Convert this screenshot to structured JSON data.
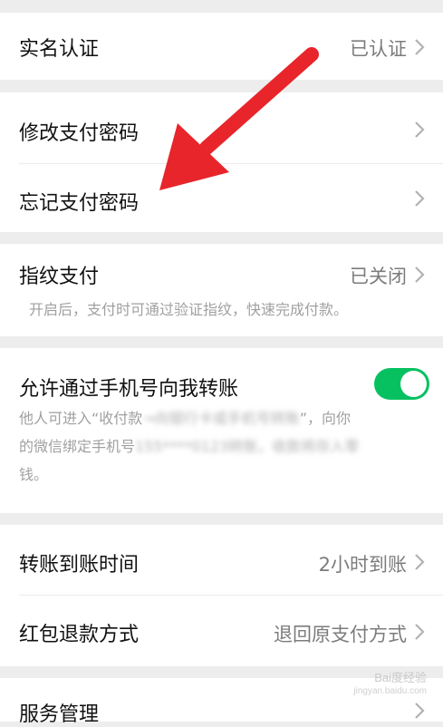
{
  "sections": {
    "realname": {
      "label": "实名认证",
      "value": "已认证"
    },
    "change_password": {
      "label": "修改支付密码"
    },
    "forgot_password": {
      "label": "忘记支付密码"
    },
    "fingerprint": {
      "label": "指纹支付",
      "value": "已关闭",
      "description": "开启后，支付时可通过验证指纹，快速完成付款。"
    },
    "phone_transfer": {
      "label": "允许通过手机号向我转账",
      "enabled": true,
      "desc_line1_a": "他人可进入“收付款",
      "desc_line1_blur": "→向银行卡或手机号转账",
      "desc_line1_b": "”，向你",
      "desc_line2_a": "的微信绑定手机号",
      "desc_line2_blur": "155****0123转账，收款将存入零",
      "desc_line3": "钱。"
    },
    "transfer_time": {
      "label": "转账到账时间",
      "value": "2小时到账"
    },
    "red_packet_refund": {
      "label": "红包退款方式",
      "value": "退回原支付方式"
    },
    "service": {
      "label": "服务管理"
    }
  },
  "watermark": {
    "line1": "Bai度经验",
    "line2": "jingyan.baidu.com"
  },
  "colors": {
    "accent": "#07c160",
    "arrow": "#e8252b",
    "background": "#ededed"
  },
  "icons": {
    "chevron": "chevron-right-icon",
    "annotation": "red-arrow-annotation"
  }
}
